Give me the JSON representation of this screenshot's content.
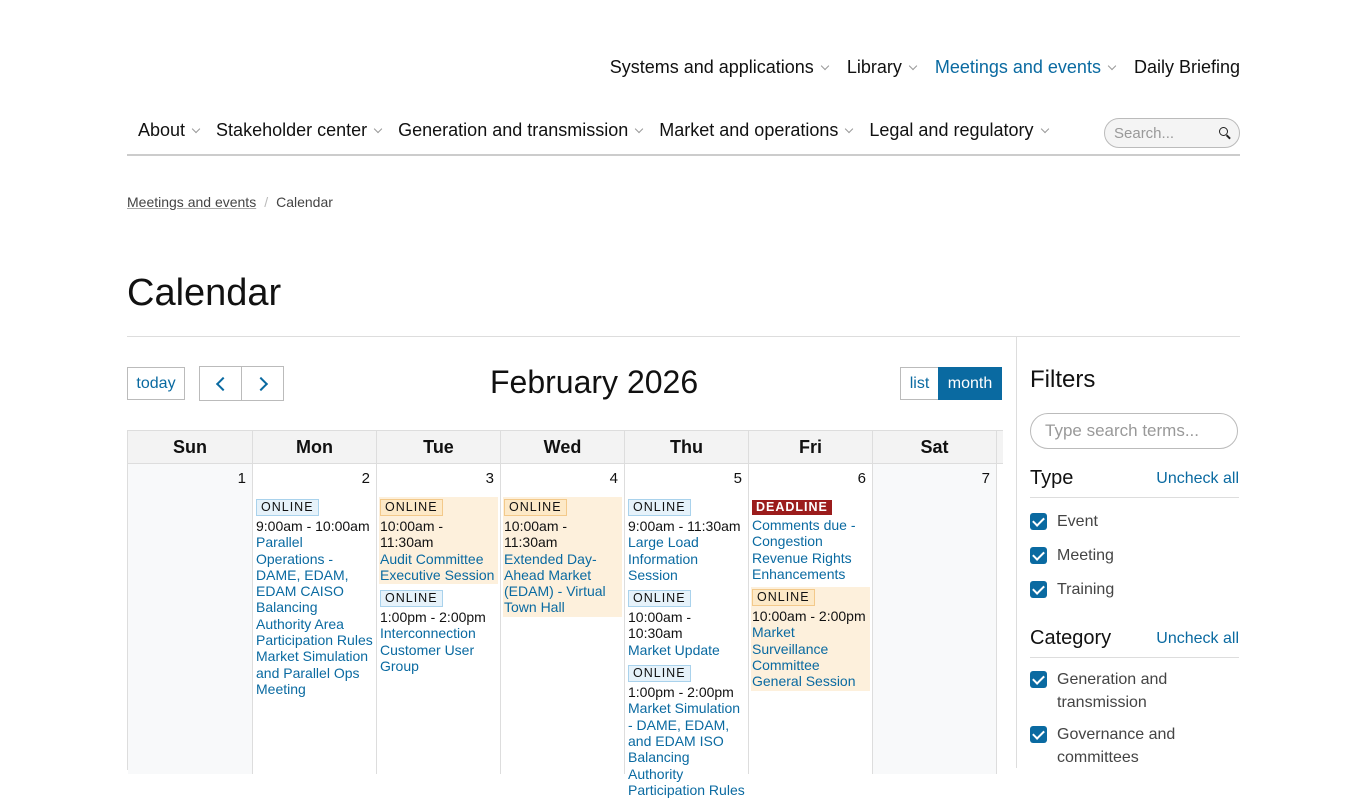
{
  "util_nav": [
    {
      "label": "Systems and applications",
      "dropdown": true,
      "active": false
    },
    {
      "label": "Library",
      "dropdown": true,
      "active": false
    },
    {
      "label": "Meetings and events",
      "dropdown": true,
      "active": true
    },
    {
      "label": "Daily Briefing",
      "dropdown": false,
      "active": false
    }
  ],
  "main_nav": [
    {
      "label": "About"
    },
    {
      "label": "Stakeholder center"
    },
    {
      "label": "Generation and transmission"
    },
    {
      "label": "Market and operations"
    },
    {
      "label": "Legal and regulatory"
    }
  ],
  "search": {
    "placeholder": "Search..."
  },
  "breadcrumb": {
    "parent": "Meetings and events",
    "separator": "/",
    "current": "Calendar"
  },
  "page_title": "Calendar",
  "toolbar": {
    "today": "today",
    "month_title": "February 2026",
    "list": "list",
    "month": "month"
  },
  "days_of_week": [
    "Sun",
    "Mon",
    "Tue",
    "Wed",
    "Thu",
    "Fri",
    "Sat"
  ],
  "week": [
    {
      "num": "1",
      "weekend": true,
      "events": []
    },
    {
      "num": "2",
      "weekend": false,
      "events": [
        {
          "tag": "ONLINE",
          "style": "blue",
          "time": "9:00am - 10:00am",
          "title": "Parallel Operations - DAME, EDAM, EDAM CAISO Balancing Authority Area Participation Rules Market Simulation and Parallel Ops Meeting"
        }
      ]
    },
    {
      "num": "3",
      "weekend": false,
      "events": [
        {
          "tag": "ONLINE",
          "style": "orange",
          "time": "10:00am - 11:30am",
          "title": "Audit Committee Executive Session"
        },
        {
          "tag": "ONLINE",
          "style": "blue",
          "time": "1:00pm - 2:00pm",
          "title": "Interconnection Customer User Group"
        }
      ]
    },
    {
      "num": "4",
      "weekend": false,
      "events": [
        {
          "tag": "ONLINE",
          "style": "orange",
          "time": "10:00am - 11:30am",
          "title": "Extended Day-Ahead Market (EDAM) - Virtual Town Hall"
        }
      ]
    },
    {
      "num": "5",
      "weekend": false,
      "events": [
        {
          "tag": "ONLINE",
          "style": "blue",
          "time": "9:00am - 11:30am",
          "title": "Large Load Information Session"
        },
        {
          "tag": "ONLINE",
          "style": "blue",
          "time": "10:00am - 10:30am",
          "title": "Market Update"
        },
        {
          "tag": "ONLINE",
          "style": "blue",
          "time": "1:00pm - 2:00pm",
          "title": "Market Simulation - DAME, EDAM, and EDAM ISO Balancing Authority Participation Rules"
        }
      ]
    },
    {
      "num": "6",
      "weekend": false,
      "events": [
        {
          "tag": "DEADLINE",
          "style": "red",
          "time": "",
          "title": "Comments due - Congestion Revenue Rights Enhancements"
        },
        {
          "tag": "ONLINE",
          "style": "orange",
          "time": "10:00am - 2:00pm",
          "title": "Market Surveillance Committee General Session"
        }
      ]
    },
    {
      "num": "7",
      "weekend": true,
      "events": []
    }
  ],
  "filters": {
    "title": "Filters",
    "search_placeholder": "Type search terms...",
    "type": {
      "label": "Type",
      "uncheck": "Uncheck all",
      "options": [
        "Event",
        "Meeting",
        "Training"
      ]
    },
    "category": {
      "label": "Category",
      "uncheck": "Uncheck all",
      "options": [
        "Generation and transmission",
        "Governance and committees"
      ]
    }
  },
  "colors": {
    "accent": "#0a6aa1",
    "deadline": "#9b1c1c",
    "online_orange": "#fde9c7",
    "online_blue": "#e6f2fa"
  }
}
